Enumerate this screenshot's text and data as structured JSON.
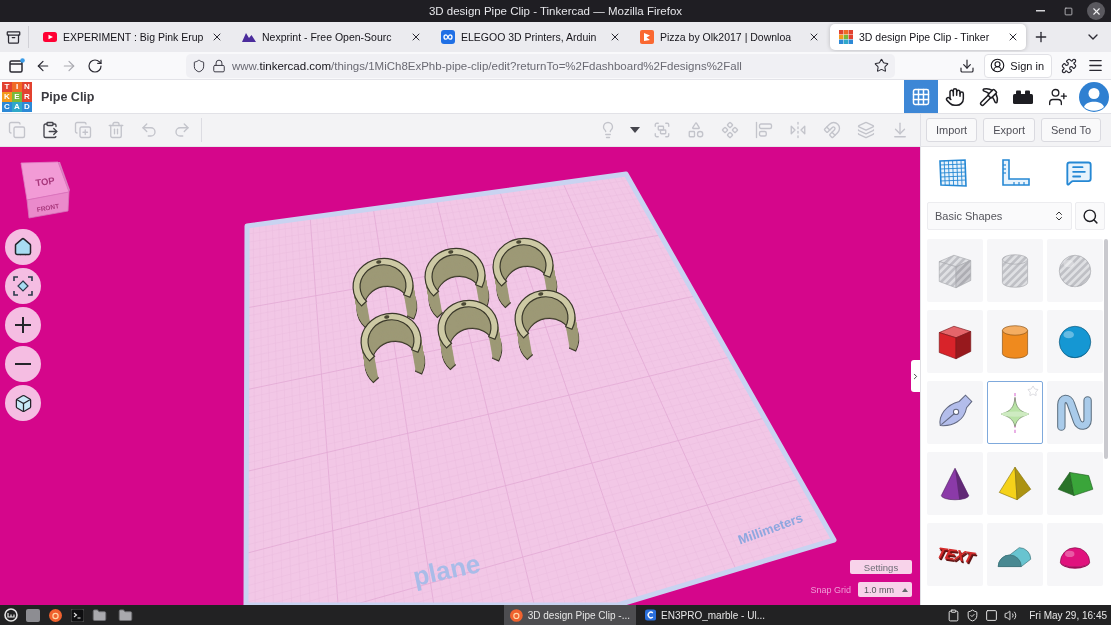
{
  "browser": {
    "title": "3D design Pipe Clip - Tinkercad — Mozilla Firefox",
    "tabs": [
      {
        "kind": "play",
        "title": "EXPERIMENT : Big Pink Erup",
        "selected": false
      },
      {
        "kind": "mountain",
        "title": "Nexprint - Free Open-Sourc",
        "selected": false
      },
      {
        "kind": "infinity",
        "title": "ELEGOO 3D Printers, Arduin",
        "selected": false
      },
      {
        "kind": "tile",
        "title": "Pizza by Olk2017 | Downloa",
        "selected": false
      },
      {
        "kind": "grid",
        "title": "3D design Pipe Clip - Tinker",
        "selected": true
      }
    ],
    "nav": [
      {
        "kind": "back",
        "disabled": false
      },
      {
        "kind": "forward",
        "disabled": true
      },
      {
        "kind": "reload",
        "disabled": false
      }
    ],
    "address": {
      "start": "www.",
      "host": "tinkercad.com",
      "rest": "/things/1MiCh8ExPhb-pipe-clip/edit?returnTo=%2Fdashboard%2Fdesigns%2Fall"
    },
    "sign_in": "Sign in"
  },
  "app": {
    "logo": [
      {
        "letter": "T",
        "color": "#e2412f"
      },
      {
        "letter": "I",
        "color": "#f06b24"
      },
      {
        "letter": "N",
        "color": "#e2412f"
      },
      {
        "letter": "K",
        "color": "#f39a1b"
      },
      {
        "letter": "E",
        "color": "#79b83a"
      },
      {
        "letter": "R",
        "color": "#e2412f"
      },
      {
        "letter": "C",
        "color": "#2c89d6"
      },
      {
        "letter": "A",
        "color": "#2fa8c9"
      },
      {
        "letter": "D",
        "color": "#2c89d6"
      }
    ],
    "design_name": "Pipe Clip",
    "modes": [
      {
        "kind": "grid",
        "selected": true
      },
      {
        "kind": "hand",
        "selected": false
      },
      {
        "kind": "pickaxe",
        "selected": false
      },
      {
        "kind": "brick",
        "selected": false
      }
    ]
  },
  "toolbar": {
    "edit_tools": [
      {
        "kind": "copy",
        "disabled": true
      },
      {
        "kind": "paste",
        "disabled": false
      },
      {
        "kind": "duplicate",
        "disabled": true
      },
      {
        "kind": "delete",
        "disabled": true
      },
      {
        "kind": "undo",
        "disabled": true
      },
      {
        "kind": "redo",
        "disabled": true
      }
    ],
    "view_tools": [
      {
        "kind": "light",
        "disabled": true
      },
      {
        "kind": "caret",
        "disabled": false
      },
      {
        "kind": "group",
        "disabled": true
      },
      {
        "kind": "solid",
        "disabled": true
      },
      {
        "kind": "hole",
        "disabled": true
      },
      {
        "kind": "align",
        "disabled": true
      },
      {
        "kind": "mirror",
        "disabled": true
      },
      {
        "kind": "cruise",
        "disabled": true
      },
      {
        "kind": "workplane",
        "disabled": true
      },
      {
        "kind": "drop",
        "disabled": true
      }
    ],
    "buttons": [
      "Import",
      "Export",
      "Send To"
    ]
  },
  "canvas": {
    "view_cube": {
      "top": "TOP",
      "front": "FRONT"
    },
    "nav_buttons": [
      {
        "kind": "home"
      },
      {
        "kind": "fit"
      },
      {
        "kind": "zoom_in"
      },
      {
        "kind": "zoom_out"
      },
      {
        "kind": "perspective"
      }
    ],
    "units": "Millimeters",
    "plane_label": "plane",
    "settings": "Settings",
    "snap_grid": {
      "label": "Snap Grid",
      "value": "1.0 mm"
    }
  },
  "panel": {
    "tools": [
      {
        "kind": "workplane"
      },
      {
        "kind": "ruler"
      },
      {
        "kind": "notes"
      }
    ],
    "library": "Basic Shapes",
    "shapes": [
      {
        "kind": "box",
        "hole": true,
        "selected": false
      },
      {
        "kind": "cylinder",
        "hole": true,
        "selected": false
      },
      {
        "kind": "sphere",
        "hole": true,
        "selected": false
      },
      {
        "kind": "box",
        "hole": false,
        "color": "#d8232a",
        "selected": false
      },
      {
        "kind": "cylinder",
        "hole": false,
        "color": "#ef8a1e",
        "selected": false
      },
      {
        "kind": "sphere",
        "hole": false,
        "color": "#1597d3",
        "selected": false
      },
      {
        "kind": "scribble",
        "hole": false,
        "color": "#b3bdeb",
        "selected": false
      },
      {
        "kind": "spin",
        "hole": false,
        "color": "#b9e3a6",
        "selected": true
      },
      {
        "kind": "wave",
        "hole": false,
        "color": "#a9cbea",
        "selected": false
      },
      {
        "kind": "cone",
        "hole": false,
        "color": "#8b3aa8",
        "selected": false
      },
      {
        "kind": "pyramid",
        "hole": false,
        "color": "#f5d21a",
        "selected": false
      },
      {
        "kind": "roof",
        "hole": false,
        "color": "#3aa53a",
        "selected": false
      },
      {
        "kind": "text",
        "hole": false,
        "color": "#d42a2a",
        "label": "TEXT",
        "selected": false
      },
      {
        "kind": "half_cylinder",
        "hole": false,
        "color": "#68c4d0",
        "selected": false
      },
      {
        "kind": "dome",
        "hole": false,
        "color": "#e0127d",
        "selected": false
      }
    ]
  },
  "taskbar": {
    "launchers": [
      {
        "kind": "menu"
      },
      {
        "kind": "desktop"
      },
      {
        "kind": "browser"
      },
      {
        "kind": "terminal"
      },
      {
        "kind": "folder"
      },
      {
        "kind": "folder"
      }
    ],
    "windows": [
      {
        "kind": "browser",
        "title": "3D design Pipe Clip -...",
        "selected": true
      },
      {
        "kind": "app",
        "title": "EN3PRO_marble - Ul...",
        "selected": false
      }
    ],
    "tray": [
      {
        "kind": "clipboard"
      },
      {
        "kind": "shield"
      },
      {
        "kind": "window"
      },
      {
        "kind": "volume"
      }
    ],
    "clock": "Fri May 29, 16:45"
  }
}
